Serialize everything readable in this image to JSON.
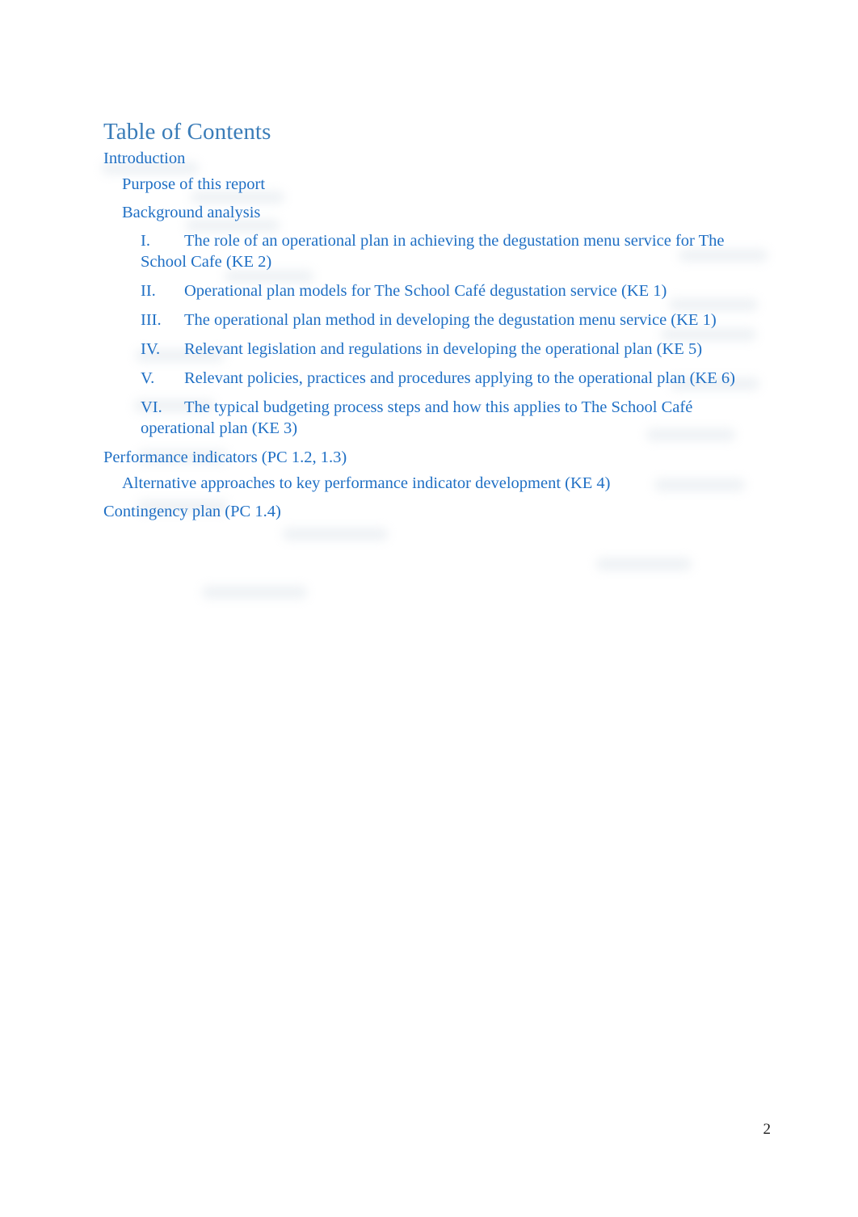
{
  "document": {
    "heading": "Table of Contents",
    "page_number": "2",
    "link_color": "#1f6fc4",
    "heading_color": "#3a7cb8",
    "page_number_color": "#1a1a1a",
    "background_color": "#ffffff"
  },
  "toc": {
    "entries": [
      {
        "level": 1,
        "number": "",
        "text": "Introduction"
      },
      {
        "level": 2,
        "number": "",
        "text": "Purpose of this report"
      },
      {
        "level": 2,
        "number": "",
        "text": "Background analysis"
      },
      {
        "level": 3,
        "number": "I.",
        "text": "The role of an operational plan in achieving the degustation menu service for The School Cafe (KE 2)"
      },
      {
        "level": 3,
        "number": "II.",
        "text": "Operational plan models for The School Café degustation service (KE 1)"
      },
      {
        "level": 3,
        "number": "III.",
        "text": "The operational plan method in developing the degustation menu service (KE 1)"
      },
      {
        "level": 3,
        "number": "IV.",
        "text": "Relevant legislation and regulations in developing the operational plan (KE 5)"
      },
      {
        "level": 3,
        "number": "V.",
        "text": "Relevant policies, practices and procedures applying to the operational plan (KE 6)"
      },
      {
        "level": 3,
        "number": "VI.",
        "text": "The typical budgeting process steps and how this applies to The School Café operational plan (KE 3)"
      },
      {
        "level": 1,
        "number": "",
        "text": "Performance indicators (PC 1.2, 1.3)"
      },
      {
        "level": 2,
        "number": "",
        "text": "Alternative approaches to key performance indicator development (KE 4)"
      },
      {
        "level": 1,
        "number": "",
        "text": "Contingency plan (PC 1.4)"
      }
    ]
  }
}
